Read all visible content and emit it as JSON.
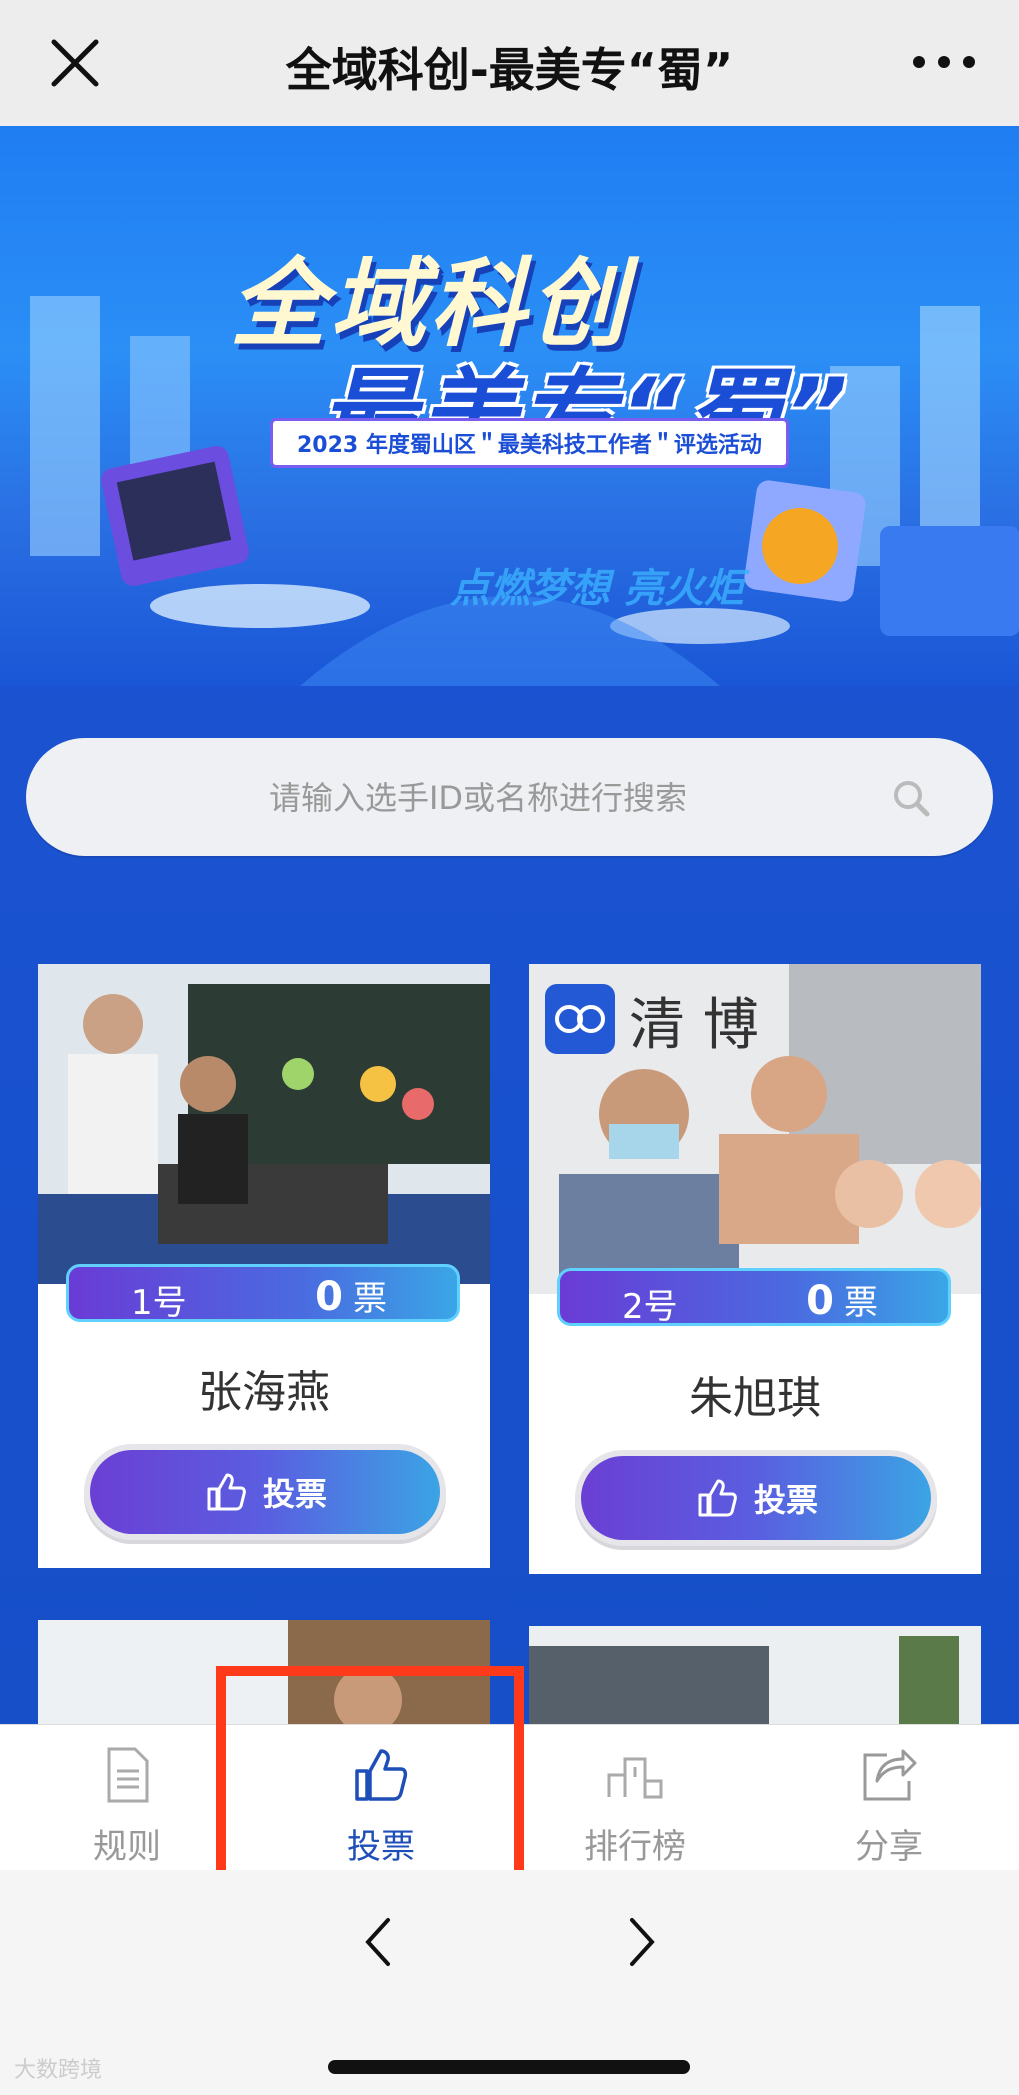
{
  "window": {
    "title": "全域科创-最美专“蜀”",
    "close_icon": "close-icon",
    "more_icon": "more-icon"
  },
  "banner": {
    "line1": "全域科创",
    "line2": "最美专“蜀”",
    "subtitle": "2023 年度蜀山区＂最美科技工作者＂评选活动",
    "slogan": "点燃梦想 亮火炬"
  },
  "search": {
    "placeholder": "请输入选手ID或名称进行搜索",
    "value": ""
  },
  "candidates": [
    {
      "number": "1号",
      "votes": "0",
      "votes_unit": "票",
      "name": "张海燕",
      "vote_label": "投票"
    },
    {
      "number": "2号",
      "votes": "0",
      "votes_unit": "票",
      "name": "朱旭琪",
      "vote_label": "投票"
    }
  ],
  "tabbar": {
    "items": [
      {
        "label": "规则",
        "icon": "document-icon"
      },
      {
        "label": "投票",
        "icon": "thumbs-up-icon",
        "active": true
      },
      {
        "label": "排行榜",
        "icon": "podium-icon"
      },
      {
        "label": "分享",
        "icon": "share-icon"
      }
    ]
  },
  "watermark": "大数跨境",
  "colors": {
    "primary": "#1a55d6",
    "accent_purple": "#6b3fd4",
    "active_tab": "#1e4fb8",
    "highlight": "#ff3a1a"
  }
}
